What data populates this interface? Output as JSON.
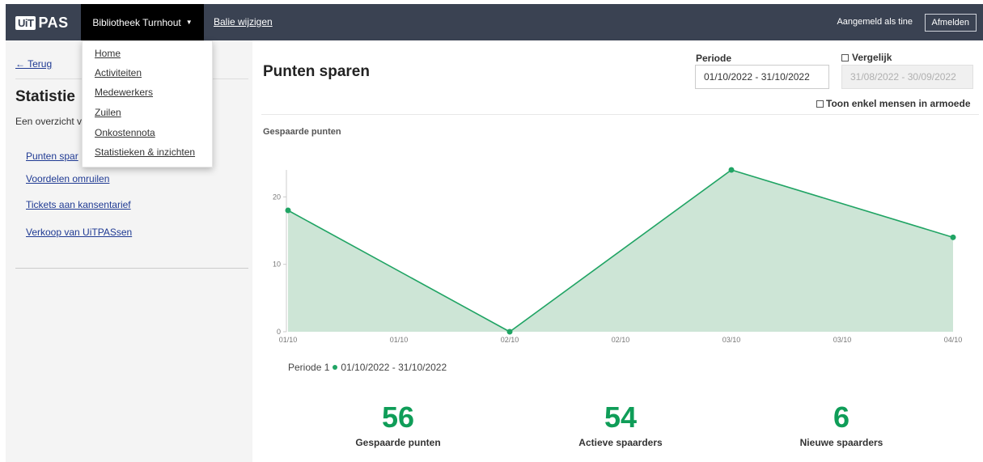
{
  "topbar": {
    "logo_uit": "UiT",
    "logo_pas": "PAS",
    "org_label": "Bibliotheek Turnhout",
    "balie_label": "Balie wijzigen",
    "logged_in": "Aangemeld als tine",
    "logout_label": "Afmelden"
  },
  "dropdown": {
    "items": [
      "Home",
      "Activiteiten",
      "Medewerkers",
      "Zuilen",
      "Onkostennota",
      "Statistieken & inzichten"
    ]
  },
  "sidebar": {
    "back_label": "← Terug",
    "title": "Statistie",
    "description": "Een overzicht v",
    "links": [
      "Punten spar",
      "Voordelen omruilen",
      "Tickets aan kansentarief",
      "Verkoop van UiTPASsen"
    ]
  },
  "main": {
    "title": "Punten sparen",
    "periode_label": "Periode",
    "periode_value": "01/10/2022 - 31/10/2022",
    "vergelijk_label": "Vergelijk",
    "vergelijk_value": "31/08/2022 - 30/09/2022",
    "armoede_label": "Toon enkel mensen in armoede",
    "chart_title": "Gespaarde punten",
    "legend_period": "Periode 1",
    "legend_range": "01/10/2022 - 31/10/2022"
  },
  "chart_data": {
    "type": "area",
    "x": [
      1,
      2,
      3,
      4
    ],
    "x_tick_labels": [
      "01/10",
      "01/10",
      "02/10",
      "02/10",
      "03/10",
      "03/10",
      "04/10"
    ],
    "x_tick_positions": [
      1,
      1.5,
      2,
      2.5,
      3,
      3.5,
      4
    ],
    "y_ticks": [
      0,
      10,
      20
    ],
    "ylim": [
      0,
      24
    ],
    "series": [
      {
        "name": "Periode 1",
        "values": [
          18,
          0,
          24,
          14
        ],
        "color": "#20a464",
        "fill": "#cde5d6"
      }
    ]
  },
  "stats": [
    {
      "value": "56",
      "label": "Gespaarde punten"
    },
    {
      "value": "54",
      "label": "Actieve spaarders"
    },
    {
      "value": "6",
      "label": "Nieuwe spaarders"
    }
  ],
  "colors": {
    "topbar": "#3a4252",
    "accent": "#0f9d58",
    "link": "#1f3a93"
  }
}
